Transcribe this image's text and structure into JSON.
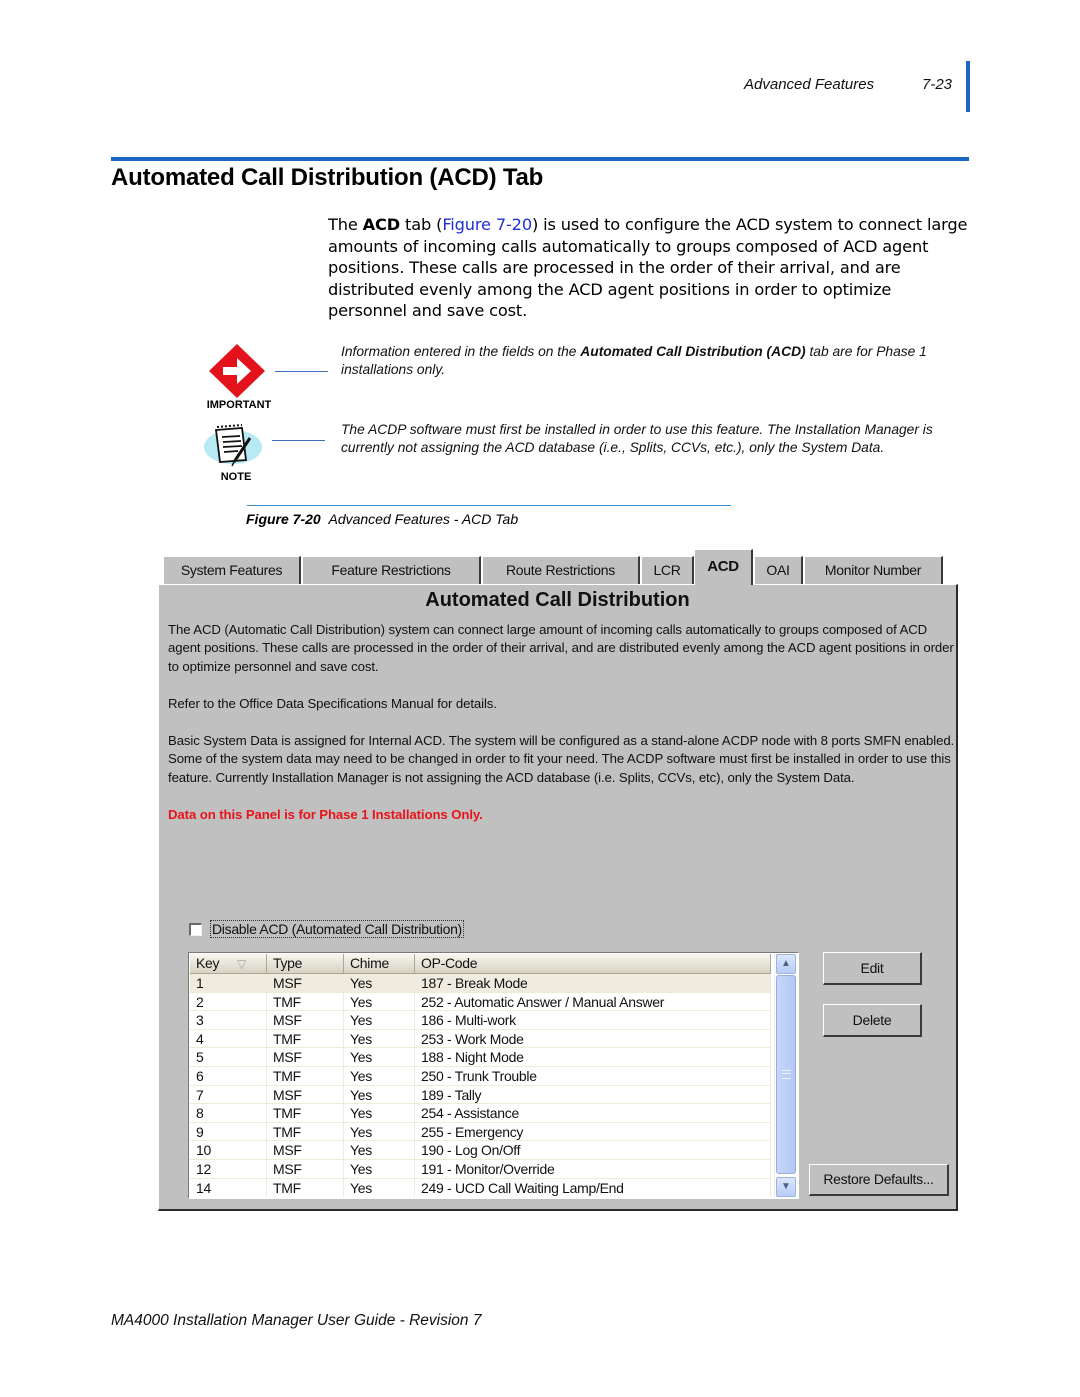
{
  "running_header": {
    "section": "Advanced Features",
    "page": "7-23"
  },
  "section_title": "Automated Call Distribution (ACD) Tab",
  "intro": {
    "pre": "The ",
    "bold": "ACD",
    "mid": " tab (",
    "link": "Figure 7-20",
    "post": ") is used to configure the ACD system to connect large amounts of incoming calls automatically to groups composed of ACD agent positions. These calls are processed in the order of their arrival, and are distributed evenly among the ACD agent positions in order to optimize personnel and save cost."
  },
  "notices": [
    {
      "icon": "important-arrow-icon",
      "caption": "IMPORTANT",
      "text_pre": "Information entered in the fields on the ",
      "text_bold": "Automated Call Distribution (ACD)",
      "text_post": " tab are for Phase 1 installations only."
    },
    {
      "icon": "note-notepad-icon",
      "caption": "NOTE",
      "text": "The ACDP software must first be installed in order to use this feature. The Installation Manager is currently not assigning the ACD database (i.e., Splits, CCVs, etc.), only the System Data."
    }
  ],
  "figure": {
    "label": "Figure 7-20",
    "caption": "Advanced Features - ACD Tab"
  },
  "app": {
    "tabs": [
      {
        "label": "System Features"
      },
      {
        "label": "Feature Restrictions"
      },
      {
        "label": "Route Restrictions"
      },
      {
        "label": "LCR"
      },
      {
        "label": "ACD",
        "active": true
      },
      {
        "label": "OAI"
      },
      {
        "label": "Monitor Number"
      }
    ],
    "panel_title": "Automated Call Distribution",
    "paragraphs": [
      "The ACD (Automatic Call Distribution) system can connect large amount of incoming calls automatically to groups composed of ACD agent positions. These calls are processed in the order of their arrival, and are distributed evenly among the ACD agent positions in order to optimize personnel and save cost.",
      "Refer to the Office Data Specifications Manual for details.",
      "Basic System Data is assigned for Internal ACD. The system will be configured as a stand-alone ACDP node with 8 ports SMFN enabled. Some of the system data may need to be changed in order to fit your need. The ACDP software must first be installed in order to use this feature. Currently Installation Manager is not assigning the ACD database (i.e. Splits, CCVs, etc), only the System Data."
    ],
    "warning": "Data on this Panel is for Phase 1 Installations Only.",
    "warning_color": "#e8131b",
    "disable_checkbox": {
      "label": "Disable ACD (Automated Call Distribution)",
      "checked": false
    },
    "table": {
      "columns": [
        "Key",
        "Type",
        "Chime",
        "OP-Code"
      ],
      "sort_column": "Key",
      "rows": [
        [
          "1",
          "MSF",
          "Yes",
          "187 - Break Mode"
        ],
        [
          "2",
          "TMF",
          "Yes",
          "252 - Automatic Answer / Manual Answer"
        ],
        [
          "3",
          "MSF",
          "Yes",
          "186 - Multi-work"
        ],
        [
          "4",
          "TMF",
          "Yes",
          "253 - Work Mode"
        ],
        [
          "5",
          "MSF",
          "Yes",
          "188 - Night Mode"
        ],
        [
          "6",
          "TMF",
          "Yes",
          "250 - Trunk Trouble"
        ],
        [
          "7",
          "MSF",
          "Yes",
          "189 - Tally"
        ],
        [
          "8",
          "TMF",
          "Yes",
          "254 - Assistance"
        ],
        [
          "9",
          "TMF",
          "Yes",
          "255 - Emergency"
        ],
        [
          "10",
          "MSF",
          "Yes",
          "190 - Log On/Off"
        ],
        [
          "12",
          "MSF",
          "Yes",
          "191 - Monitor/Override"
        ],
        [
          "14",
          "TMF",
          "Yes",
          "249 - UCD Call Waiting Lamp/End"
        ]
      ],
      "selected_row": 0
    },
    "buttons": {
      "edit": "Edit",
      "delete": "Delete",
      "restore": "Restore Defaults..."
    }
  },
  "footer": "MA4000 Installation Manager User Guide - Revision 7"
}
